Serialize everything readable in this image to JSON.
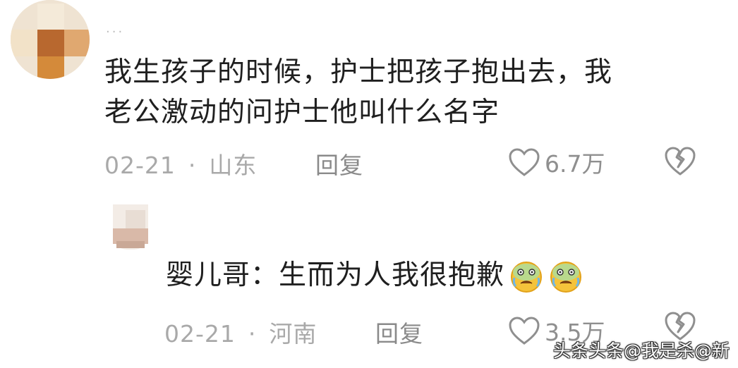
{
  "comment": {
    "text_line1": "我生孩子的时候，护士把孩子抱出去，我",
    "text_line2": "老公激动的问护士他叫什么名字",
    "date": "02-21",
    "separator": "·",
    "location": "山东",
    "reply_label": "回复",
    "likes": "6.7万",
    "more_indicator": "..."
  },
  "reply": {
    "author": "婴儿哥",
    "colon": "：",
    "text": "生而为人我很抱歉",
    "emoji": [
      "crying-face-emoji",
      "crying-face-emoji"
    ],
    "date": "02-21",
    "separator": "·",
    "location": "河南",
    "reply_label": "回复",
    "likes": "3.5万"
  },
  "watermark": "头条头条@我是杀@新",
  "colors": {
    "text": "#1f1f1f",
    "meta": "#a9a9a9",
    "icon": "#8f8f8f"
  }
}
